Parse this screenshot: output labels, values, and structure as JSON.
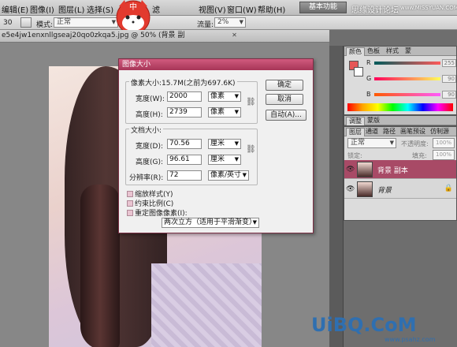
{
  "menu": {
    "items": [
      "编辑(E)",
      "图像(I)",
      "图层(L)",
      "选择(S)",
      "滤",
      "视图(V)",
      "窗口(W)",
      "帮助(H)"
    ],
    "workspace_label": "基本功能",
    "site_text_1": "思缘设计论坛",
    "site_text_2": "www.MISSYUAN.COM"
  },
  "options": {
    "size_value": "30",
    "mode_label": "模式:",
    "mode_value": "正常",
    "flow_label": "流量:",
    "flow_value": "2%"
  },
  "mascot": {
    "label": "中"
  },
  "document": {
    "tab_title": "e5e4jw1enxnllgseaj20qo0zkqa5.jpg @ 50% (背景 副"
  },
  "dialog": {
    "title": "图像大小",
    "pixel_dimensions": "像素大小:15.7M(之前为697.6K)",
    "width_label": "宽度(W):",
    "width_value": "2000",
    "width_unit": "像素",
    "height_label": "高度(H):",
    "height_value": "2739",
    "height_unit": "像素",
    "doc_size": "文档大小:",
    "doc_width_label": "宽度(D):",
    "doc_width_value": "70.56",
    "doc_width_unit": "厘米",
    "doc_height_label": "高度(G):",
    "doc_height_value": "96.61",
    "doc_height_unit": "厘米",
    "resolution_label": "分辨率(R):",
    "resolution_value": "72",
    "resolution_unit": "像素/英寸",
    "ok_label": "确定",
    "cancel_label": "取消",
    "auto_label": "自动(A)...",
    "check_scale_styles": "缩放样式(Y)",
    "check_constrain": "约束比例(C)",
    "check_resample": "重定图像像素(I):",
    "resample_method": "两次立方（适用于平滑渐变）"
  },
  "color_panel": {
    "tabs": [
      "颜色",
      "色板",
      "样式",
      "蒙"
    ],
    "r_label": "R",
    "g_label": "G",
    "b_label": "B",
    "r_value": "255",
    "g_value": "90",
    "b_value": "90",
    "fg_color": "#e65858",
    "bg_color": "#ffffff"
  },
  "adjust_panel": {
    "tabs": [
      "调整",
      "蒙版"
    ]
  },
  "layers_panel": {
    "tabs": [
      "图层",
      "通道",
      "路径",
      "画笔预设",
      "仿制源"
    ],
    "blend_mode": "正常",
    "opacity_label": "不透明度:",
    "opacity_value": "100%",
    "lock_label": "锁定:",
    "fill_label": "填充:",
    "fill_value": "100%",
    "layers": [
      {
        "name": "背景 副本",
        "active": true
      },
      {
        "name": "背景",
        "active": false
      }
    ]
  },
  "watermark": {
    "main": "UiBQ.CoM",
    "sub": "www.psahz.com"
  },
  "colors": {
    "accent": "#a63557",
    "active_layer": "#a84a66"
  }
}
